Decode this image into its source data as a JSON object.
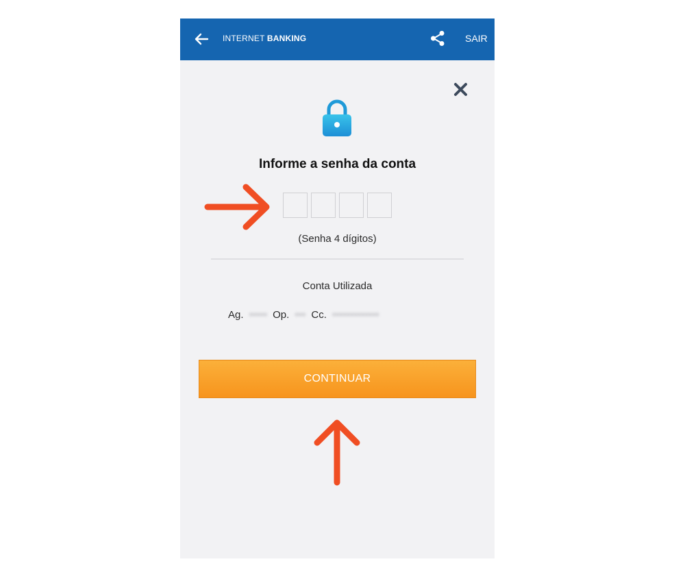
{
  "header": {
    "title_prefix": "INTERNET ",
    "title_bold": "BANKING",
    "exit_label": "SAIR",
    "background_color": "#1565b0",
    "icons": {
      "back": "arrow-left-icon",
      "share": "share-icon"
    }
  },
  "dialog": {
    "close_icon": "close-icon",
    "lock_icon": "lock-icon",
    "heading": "Informe a senha da conta",
    "pin_hint": "(Senha 4 dígitos)",
    "account_label": "Conta Utilizada",
    "account": {
      "ag_label": "Ag.",
      "ag_value": "•••••",
      "op_label": "Op.",
      "op_value": "•••",
      "cc_label": "Cc.",
      "cc_value": "•••••••••••••"
    },
    "continue_label": "CONTINUAR",
    "button_color": "#f7941d"
  },
  "annotations": {
    "arrow_color": "#f04e23"
  }
}
